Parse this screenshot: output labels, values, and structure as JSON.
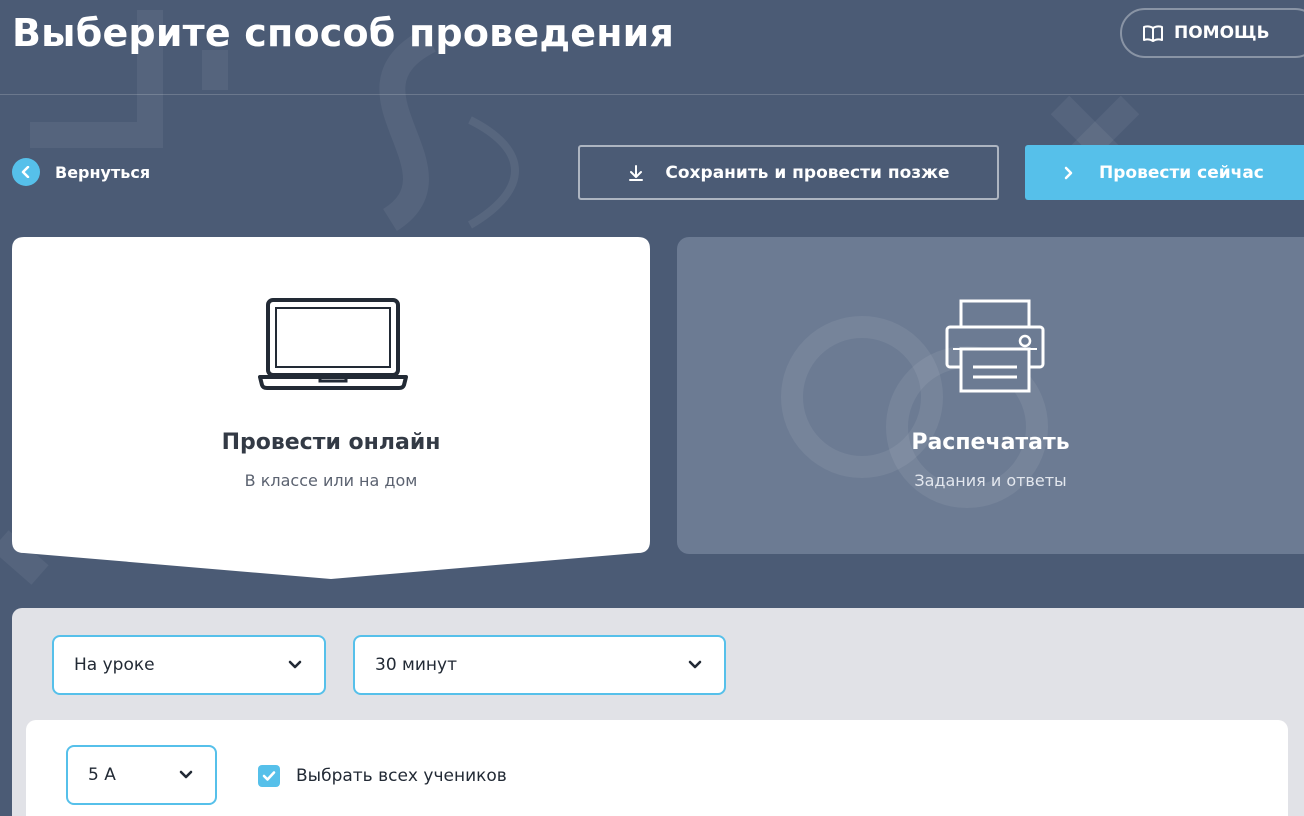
{
  "header": {
    "title": "Выберите способ проведения",
    "help_label": "ПОМОЩЬ"
  },
  "nav": {
    "back_label": "Вернуться"
  },
  "actions": {
    "save_later_label": "Сохранить и провести позже",
    "run_now_label": "Провести сейчас"
  },
  "modes": {
    "online": {
      "title": "Провести онлайн",
      "subtitle": "В классе или на дом",
      "icon": "laptop-icon",
      "selected": true
    },
    "print": {
      "title": "Распечатать",
      "subtitle": "Задания и ответы",
      "icon": "printer-icon",
      "selected": false
    }
  },
  "settings": {
    "when_value": "На уроке",
    "duration_value": "30 минут",
    "class_value": "5 А",
    "select_all_label": "Выбрать всех учеников",
    "select_all_checked": true
  },
  "colors": {
    "background": "#4b5b75",
    "accent": "#56c0ea",
    "card_selected": "#ffffff",
    "card_unselected": "#6c7b93",
    "panel": "#e1e2e7"
  }
}
